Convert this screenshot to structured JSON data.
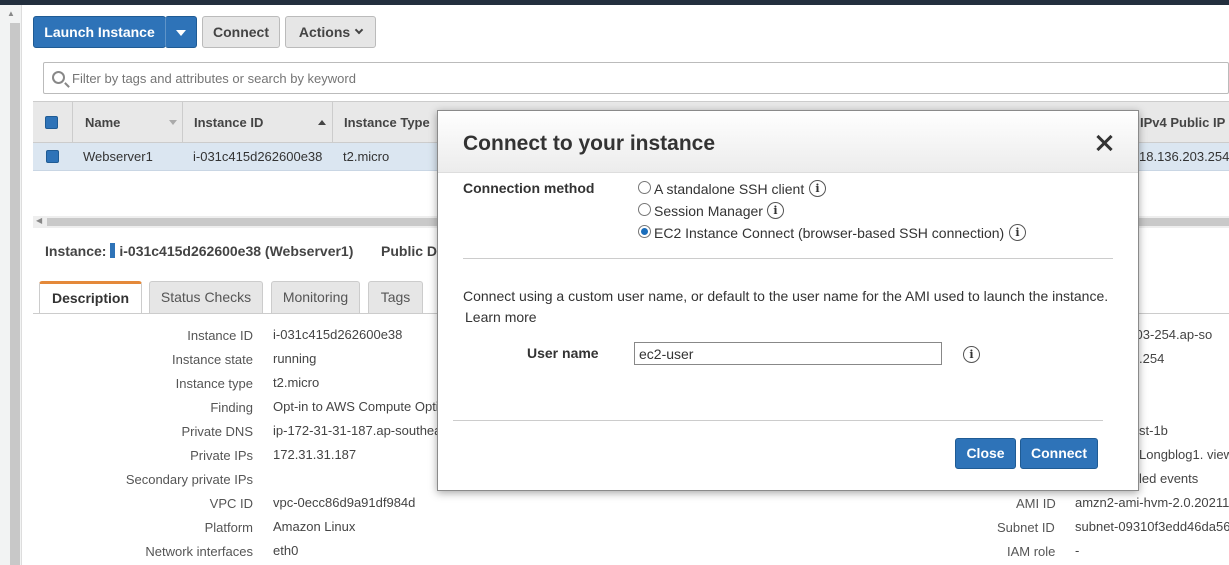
{
  "toolbar": {
    "launch_label": "Launch Instance",
    "connect_label": "Connect",
    "actions_label": "Actions"
  },
  "search": {
    "placeholder": "Filter by tags and attributes or search by keyword"
  },
  "grid": {
    "headers": {
      "name": "Name",
      "instance_id": "Instance ID",
      "instance_type": "Instance Type",
      "public_ip": "IPv4 Public IP"
    },
    "rows": [
      {
        "name": "Webserver1",
        "instance_id": "i-031c415d262600e38",
        "instance_type": "t2.micro",
        "public_ip": "18.136.203.254"
      }
    ]
  },
  "detail": {
    "instance_prefix": "Instance:",
    "instance_value": "i-031c415d262600e38 (Webserver1)",
    "public_dns_label": "Public D",
    "tabs": [
      "Description",
      "Status Checks",
      "Monitoring",
      "Tags"
    ],
    "left": [
      {
        "key": "Instance ID",
        "value": "i-031c415d262600e38"
      },
      {
        "key": "Instance state",
        "value": "running"
      },
      {
        "key": "Instance type",
        "value": "t2.micro"
      },
      {
        "key": "Finding",
        "value": "Opt-in to AWS Compute Opti"
      },
      {
        "key": "Private DNS",
        "value": "ip-172-31-31-187.ap-southea"
      },
      {
        "key": "Private IPs",
        "value": "172.31.31.187"
      },
      {
        "key": "Secondary private IPs",
        "value": ""
      },
      {
        "key": "VPC ID",
        "value": "vpc-0ecc86d9a91df984d"
      },
      {
        "key": "Platform",
        "value": "Amazon Linux"
      },
      {
        "key": "Network interfaces",
        "value": "eth0"
      }
    ],
    "right": [
      {
        "key": "",
        "value": "-203-254.ap-so"
      },
      {
        "key": "",
        "value": ".254"
      },
      {
        "key": "",
        "value": "st-1b"
      },
      {
        "key": "",
        "value": "Longblog1. view"
      },
      {
        "key": "",
        "value": "led events"
      },
      {
        "key": "AMI ID",
        "value": "amzn2-ami-hvm-2.0.20211"
      },
      {
        "key": "Subnet ID",
        "value": "subnet-09310f3edd46da56"
      },
      {
        "key": "IAM role",
        "value": "-"
      }
    ]
  },
  "modal": {
    "title": "Connect to your instance",
    "connection_method_label": "Connection method",
    "options": [
      {
        "label": "A standalone SSH client",
        "selected": false
      },
      {
        "label": "Session Manager",
        "selected": false
      },
      {
        "label": "EC2 Instance Connect (browser-based SSH connection)",
        "selected": true
      }
    ],
    "description": "Connect using a custom user name, or default to the user name for the AMI used to launch the instance.",
    "learn_more": "Learn more",
    "user_name_label": "User name",
    "user_name_value": "ec2-user",
    "close_label": "Close",
    "connect_label": "Connect",
    "info_glyph": "i"
  },
  "colors": {
    "primary": "#2e73b8",
    "link": "#1a6dbb",
    "tab_accent": "#e4893a",
    "selected_row": "#dbe6f1"
  }
}
